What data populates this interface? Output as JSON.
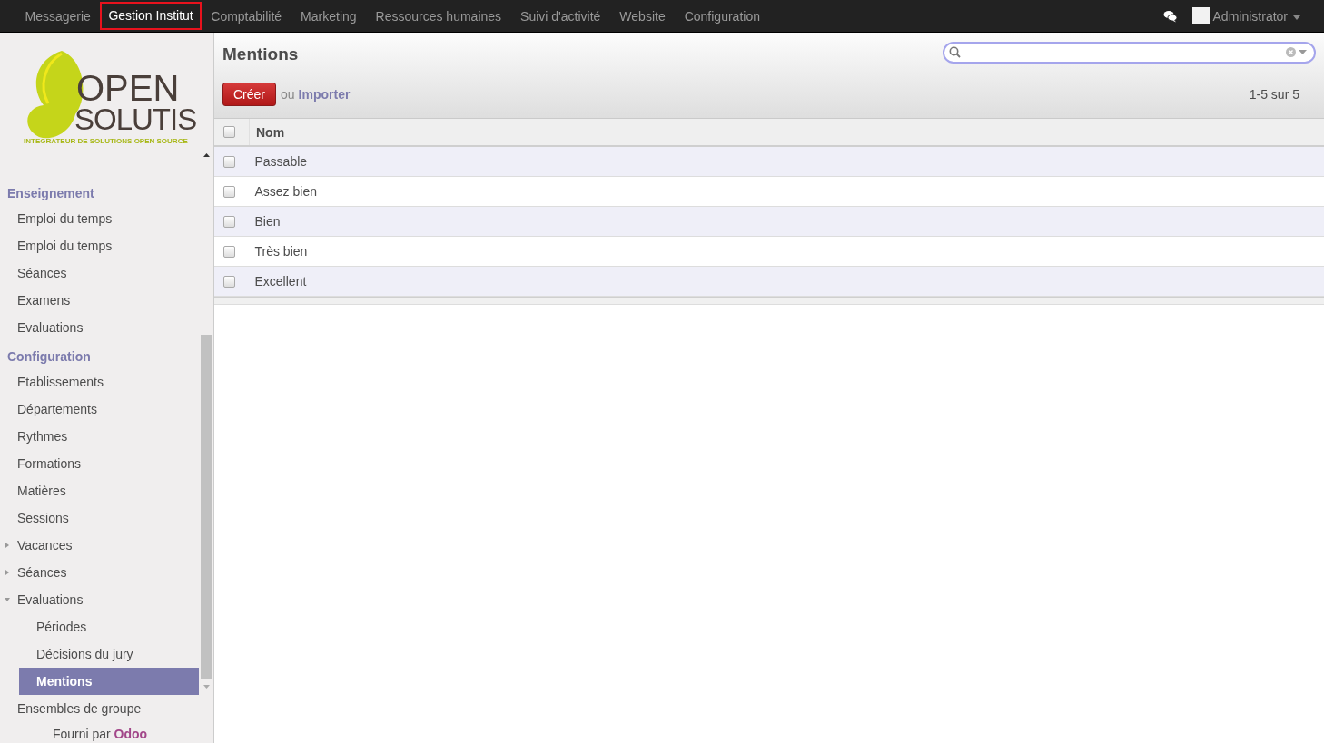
{
  "menu": [
    {
      "label": "Messagerie",
      "selected": false
    },
    {
      "label": "Gestion Institut",
      "selected": true
    },
    {
      "label": "Comptabilité",
      "selected": false
    },
    {
      "label": "Marketing",
      "selected": false
    },
    {
      "label": "Ressources humaines",
      "selected": false
    },
    {
      "label": "Suivi d'activité",
      "selected": false
    },
    {
      "label": "Website",
      "selected": false
    },
    {
      "label": "Configuration",
      "selected": false
    }
  ],
  "user": {
    "name": "Administrator"
  },
  "logo": {
    "line_1": "OPEN",
    "line_2": "SOLUTIS",
    "tagline": "INTEGRATEUR DE SOLUTIONS OPEN SOURCE"
  },
  "sidebar": {
    "sections": [
      {
        "title": "Enseignement",
        "items": [
          {
            "label": "Emploi du temps",
            "selected": false
          },
          {
            "label": "Emploi du temps",
            "selected": false
          },
          {
            "label": "Séances",
            "selected": false
          },
          {
            "label": "Examens",
            "selected": false
          },
          {
            "label": "Evaluations",
            "selected": false
          }
        ]
      },
      {
        "title": "Configuration",
        "items": [
          {
            "label": "Etablissements",
            "selected": false
          },
          {
            "label": "Départements",
            "selected": false
          },
          {
            "label": "Rythmes",
            "selected": false
          },
          {
            "label": "Formations",
            "selected": false
          },
          {
            "label": "Matières",
            "selected": false
          },
          {
            "label": "Sessions",
            "selected": false
          },
          {
            "label": "Vacances",
            "selected": false,
            "expanded": false
          },
          {
            "label": "Séances",
            "selected": false,
            "expanded": false
          },
          {
            "label": "Evaluations",
            "selected": false,
            "expanded": true,
            "children": [
              {
                "label": "Périodes",
                "selected": false
              },
              {
                "label": "Décisions du jury",
                "selected": false
              },
              {
                "label": "Mentions",
                "selected": true
              }
            ]
          },
          {
            "label": "Ensembles de groupe",
            "selected": false
          }
        ]
      }
    ],
    "footer_text": "Fourni par",
    "footer_link": "Odoo"
  },
  "view": {
    "title": "Mentions",
    "create_button": "Créer",
    "or_text": "ou",
    "import_link": "Importer",
    "pager": "1-5 sur 5"
  },
  "table": {
    "columns": [
      "Nom"
    ],
    "all_selected": false,
    "rows": [
      {
        "cells": [
          "Passable"
        ],
        "selected": false
      },
      {
        "cells": [
          "Assez bien"
        ],
        "selected": false
      },
      {
        "cells": [
          "Bien"
        ],
        "selected": false
      },
      {
        "cells": [
          "Très bien"
        ],
        "selected": false
      },
      {
        "cells": [
          "Excellent"
        ],
        "selected": false
      }
    ]
  }
}
